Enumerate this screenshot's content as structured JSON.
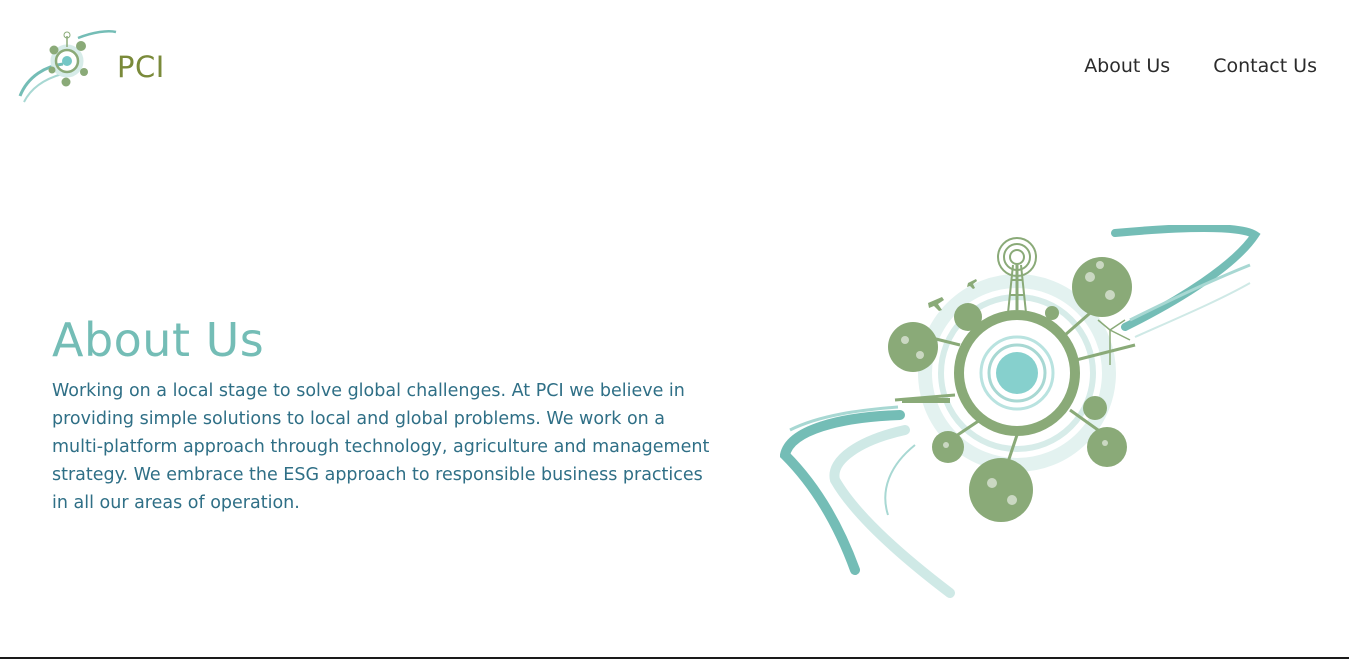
{
  "brand": {
    "name": "PCI"
  },
  "nav": {
    "items": [
      {
        "label": "About Us"
      },
      {
        "label": "Contact Us"
      }
    ]
  },
  "about": {
    "title": "About Us",
    "body": "Working on a local stage to solve global challenges. At PCI we believe in providing simple solutions to local and global problems. We work on a multi-platform approach through technology, agriculture and management strategy. We embrace the ESG approach to responsible business practices in all our areas of operation."
  },
  "colors": {
    "teal": "#74bdb6",
    "teal_light": "#cfe9e6",
    "green": "#8aaa78",
    "brand_text": "#7a8a3a",
    "body_text": "#2f6f86",
    "nav_text": "#2b2b2b"
  },
  "icons": {
    "logo": "globe-tree-logo-icon",
    "hero": "green-globe-illustration"
  }
}
